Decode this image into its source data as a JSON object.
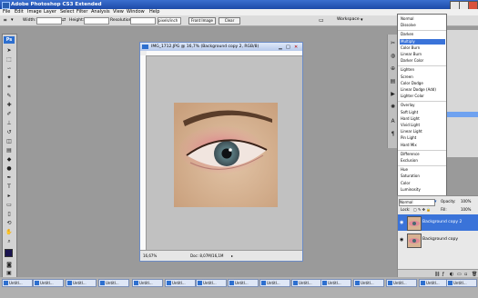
{
  "app": {
    "title": "Adobe Photoshop CS3 Extended"
  },
  "menu": [
    "File",
    "Edit",
    "Image",
    "Layer",
    "Select",
    "Filter",
    "Analysis",
    "View",
    "Window",
    "Help"
  ],
  "options_bar": {
    "width_label": "Width:",
    "height_label": "Height:",
    "resolution_label": "Resolution:",
    "resolution_unit": "pixels/inch",
    "front_image_label": "Front Image",
    "clear_label": "Clear",
    "workspace_label": "Workspace"
  },
  "document": {
    "title": "IMG_1712.JPG @ 16,7% (Background copy 2, RGB/8)",
    "zoom": "16,67%",
    "doc_size": "Doc: 8,07M/16,1M"
  },
  "blend_menu": {
    "groups": [
      [
        "Normal",
        "Dissolve"
      ],
      [
        "Darken",
        "Multiply",
        "Color Burn",
        "Linear Burn",
        "Darker Color"
      ],
      [
        "Lighten",
        "Screen",
        "Color Dodge",
        "Linear Dodge (Add)",
        "Lighter Color"
      ],
      [
        "Overlay",
        "Soft Light",
        "Hard Light",
        "Vivid Light",
        "Linear Light",
        "Pin Light",
        "Hard Mix"
      ],
      [
        "Difference",
        "Exclusion"
      ],
      [
        "Hue",
        "Saturation",
        "Color",
        "Luminosity"
      ]
    ],
    "selected": "Multiply"
  },
  "layers": {
    "mode": "Normal",
    "opacity_label": "Opacity:",
    "opacity_value": "100%",
    "lock_label": "Lock:",
    "fill_label": "Fill:",
    "fill_value": "100%",
    "rows": [
      {
        "name": "Background copy 2",
        "active": true
      },
      {
        "name": "Background copy",
        "active": false
      }
    ]
  },
  "taskbar": {
    "items": [
      "Untitl...",
      "Untitl...",
      "Untitl...",
      "Untitl...",
      "Untitl...",
      "Untitl...",
      "Untitl...",
      "Untitl...",
      "Untitl...",
      "Untitl...",
      "Untitl...",
      "Untitl...",
      "Untitl...",
      "Untitl...",
      "Untitl..."
    ]
  },
  "colors": {
    "title_bar": "#1c4aa8",
    "selection": "#3a73d9",
    "workspace_bg": "#9a9a9a"
  }
}
